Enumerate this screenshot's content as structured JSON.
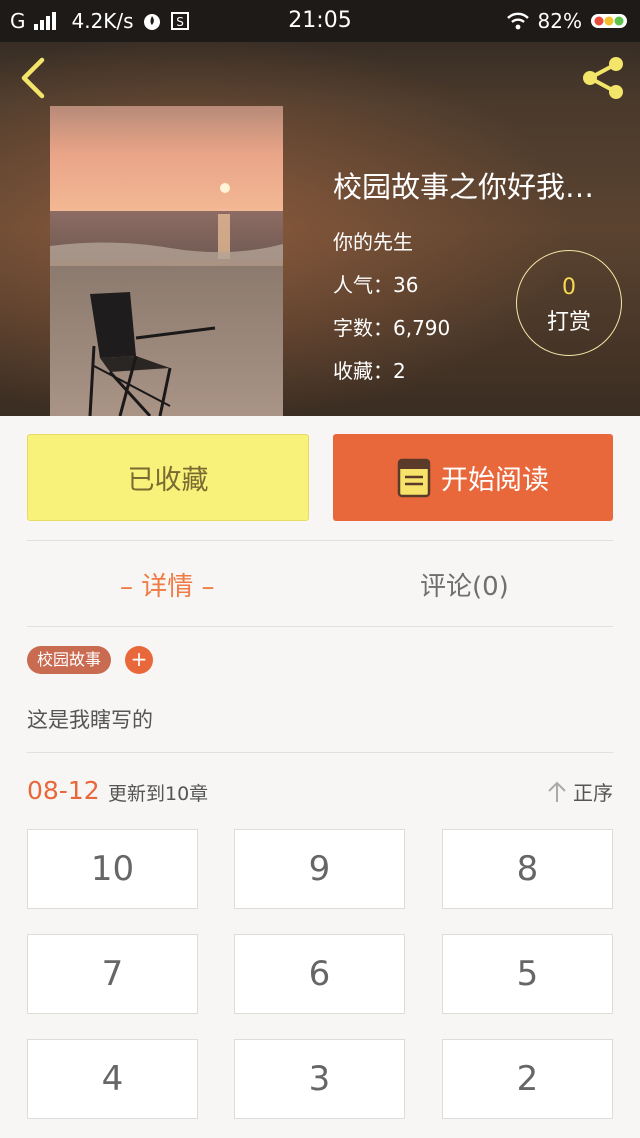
{
  "status_bar": {
    "carrier": "G",
    "speed": "4.2K/s",
    "time": "21:05",
    "battery": "82%"
  },
  "book": {
    "title": "校园故事之你好我…",
    "author": "你的先生",
    "popularity": "人气：36",
    "word_count": "字数：6,790",
    "favorites": "收藏：2"
  },
  "reward": {
    "count": "0",
    "label": "打赏"
  },
  "actions": {
    "collect_label": "已收藏",
    "read_label": "开始阅读"
  },
  "tabs": {
    "detail": "– 详情 –",
    "comment": "评论(0)"
  },
  "tags": [
    "校园故事"
  ],
  "tag_add": "+",
  "description": "这是我瞎写的",
  "chapters": {
    "update_date": "08-12",
    "update_text": "更新到10章",
    "sort_label": "正序",
    "items": [
      "10",
      "9",
      "8",
      "7",
      "6",
      "5",
      "4",
      "3",
      "2"
    ]
  },
  "colors": {
    "accent": "#e8683c",
    "collect_bg": "#f8f17a",
    "reward_count": "#f5d950",
    "tab_active": "#ef7a44"
  }
}
